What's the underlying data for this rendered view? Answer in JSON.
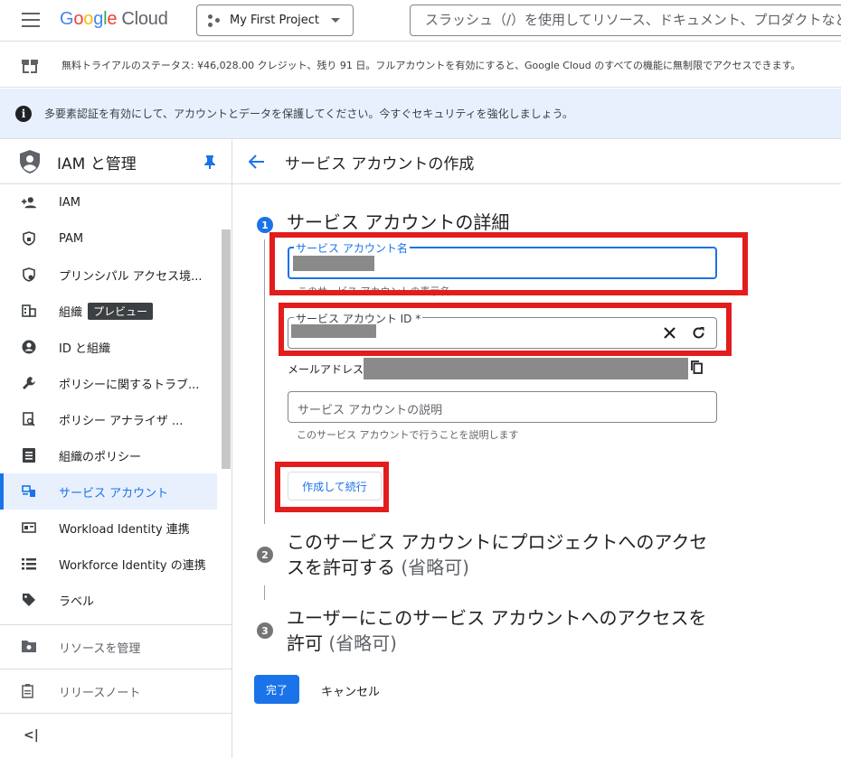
{
  "header": {
    "logo_google": "Google",
    "logo_cloud": "Cloud",
    "project": "My First Project",
    "search_placeholder": "スラッシュ（/）を使用してリソース、ドキュメント、プロダクトなど"
  },
  "trial_banner": "無料トライアルのステータス: ¥46,028.00 クレジット、残り 91 日。フルアカウントを有効にすると、Google Cloud のすべての機能に無制限でアクセスできます。",
  "mfa_banner": "多要素認証を有効にして、アカウントとデータを保護してください。今すぐセキュリティを強化しましょう。",
  "sidebar": {
    "title": "IAM と管理",
    "items": [
      {
        "label": "IAM",
        "icon": "person-add-icon"
      },
      {
        "label": "PAM",
        "icon": "shield-lock-icon"
      },
      {
        "label": "プリンシパル アクセス境...",
        "icon": "shield-gear-icon"
      },
      {
        "label": "組織",
        "badge": "プレビュー",
        "icon": "building-icon"
      },
      {
        "label": "ID と組織",
        "icon": "account-circle-icon"
      },
      {
        "label": "ポリシーに関するトラブ...",
        "icon": "wrench-icon"
      },
      {
        "label": "ポリシー アナライザ ...",
        "icon": "doc-search-icon"
      },
      {
        "label": "組織のポリシー",
        "icon": "list-doc-icon"
      },
      {
        "label": "サービス アカウント",
        "icon": "service-account-icon"
      },
      {
        "label": "Workload Identity 連携",
        "icon": "id-card-icon"
      },
      {
        "label": "Workforce Identity の連携",
        "icon": "list-icon"
      },
      {
        "label": "ラベル",
        "icon": "tag-icon"
      }
    ],
    "manage_resources": "リソースを管理",
    "release_notes": "リリースノート",
    "collapse": "<|"
  },
  "main": {
    "title": "サービス アカウントの作成",
    "step1": {
      "num": "1",
      "title": "サービス アカウントの詳細",
      "name_label": "サービス アカウント名",
      "name_hint": "このサービス アカウントの表示名",
      "id_label": "サービス アカウント ID *",
      "email_label": "メールアドレス:",
      "desc_placeholder": "サービス アカウントの説明",
      "desc_hint": "このサービス アカウントで行うことを説明します",
      "create_button": "作成して続行"
    },
    "step2": {
      "num": "2",
      "title_line1": "このサービス アカウントにプロジェクトへのアクセ",
      "title_line2": "スを許可する",
      "optional": "(省略可)"
    },
    "step3": {
      "num": "3",
      "title_line1": "ユーザーにこのサービス アカウントへのアクセスを",
      "title_line2": "許可",
      "optional": "(省略可)"
    },
    "done_button": "完了",
    "cancel_button": "キャンセル"
  },
  "colors": {
    "accent": "#1a73e8",
    "highlight_box": "#e31c1c"
  }
}
